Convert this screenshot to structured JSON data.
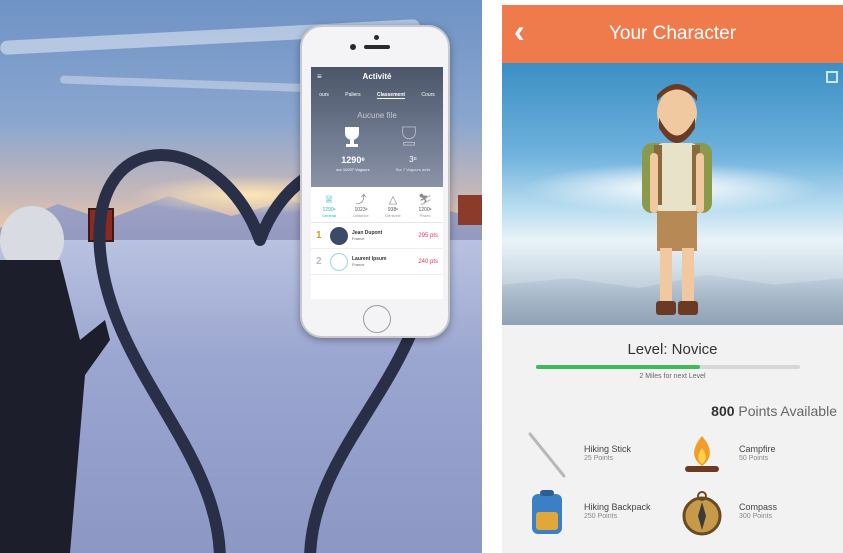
{
  "phone": {
    "title": "Activité",
    "menu_icon": "hamburger-icon",
    "tabs": [
      "ours",
      "Paliers",
      "Classement",
      "Cours"
    ],
    "empty_text": "Aucune file",
    "rank": "1290ᵉ",
    "rank_sub": "sur 10207 Vagours",
    "rank2": "3ᵉ",
    "rank2_sub": "Sur 7 Vagours amis",
    "categories": [
      {
        "icon": "trophy-icon",
        "value": "1290ᵉ",
        "label": "Général"
      },
      {
        "icon": "distance-icon",
        "value": "1023ᵉ",
        "label": "Distance"
      },
      {
        "icon": "mountain-icon",
        "value": "938ᵉ",
        "label": "Dénivelé"
      },
      {
        "icon": "skier-icon",
        "value": "1200ᵉ",
        "label": "Pistes"
      }
    ],
    "leaderboard": [
      {
        "position": "1",
        "name": "Jean Dupont",
        "country": "France",
        "points": "295 pts"
      },
      {
        "position": "2",
        "name": "Laurent Ipsum",
        "country": "France",
        "points": "240 pts"
      }
    ]
  },
  "app": {
    "title": "Your Character",
    "back_icon": "chevron-left-icon",
    "expand_icon": "expand-icon",
    "level": "Level: Novice",
    "progress_fraction": 0.62,
    "progress_note": "2 Miles for next Level",
    "points_value": "800",
    "points_label": "Points Available",
    "items": [
      {
        "name": "Hiking Stick",
        "points": "25 Points",
        "icon": "hiking-stick-icon"
      },
      {
        "name": "Campfire",
        "points": "50 Points",
        "icon": "campfire-icon"
      },
      {
        "name": "Hiking Backpack",
        "points": "250 Points",
        "icon": "backpack-icon"
      },
      {
        "name": "Compass",
        "points": "300 Points",
        "icon": "compass-icon"
      }
    ],
    "colors": {
      "header": "#ef7b4d",
      "progress": "#3dbb59",
      "accent": "#26b3c8",
      "points_red": "#e2395a"
    }
  }
}
